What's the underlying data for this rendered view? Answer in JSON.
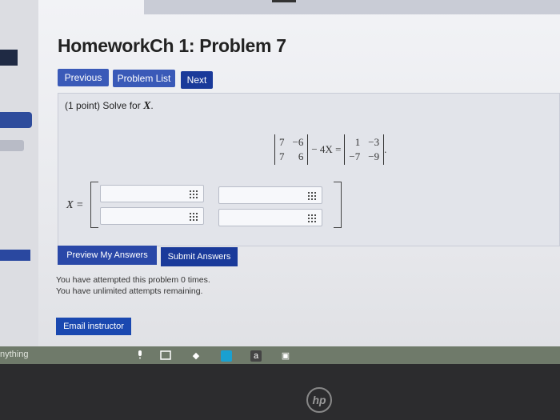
{
  "page": {
    "title": "HomeworkCh 1: Problem 7"
  },
  "nav": {
    "previous": "Previous",
    "problem_list": "Problem List",
    "next": "Next"
  },
  "problem": {
    "points": "(1 point) Solve for",
    "variable": "X",
    "matrix_a": [
      "7",
      "−6",
      "7",
      "6"
    ],
    "operator_minus": "− 4X =",
    "matrix_b": [
      "1",
      "−3",
      "−7",
      "−9"
    ],
    "period": ".",
    "answer_label": "X ="
  },
  "actions": {
    "preview": "Preview My Answers",
    "submit": "Submit Answers",
    "email": "Email instructor"
  },
  "status": {
    "attempted": "You have attempted this problem 0 times.",
    "remaining": "You have unlimited attempts remaining."
  },
  "taskbar": {
    "search_text": "nything",
    "amazon_label": "a"
  },
  "icons": {
    "grid": "grid-icon",
    "mic": "microphone-icon",
    "taskview": "task-view-icon",
    "dropbox": "dropbox-icon",
    "store": "store-icon",
    "amazon": "amazon-icon",
    "brand": "hp-logo"
  },
  "colors": {
    "button_blue": "#1a3a9a",
    "panel": "#e2e4ea",
    "taskbar": "#6f7a6a"
  }
}
